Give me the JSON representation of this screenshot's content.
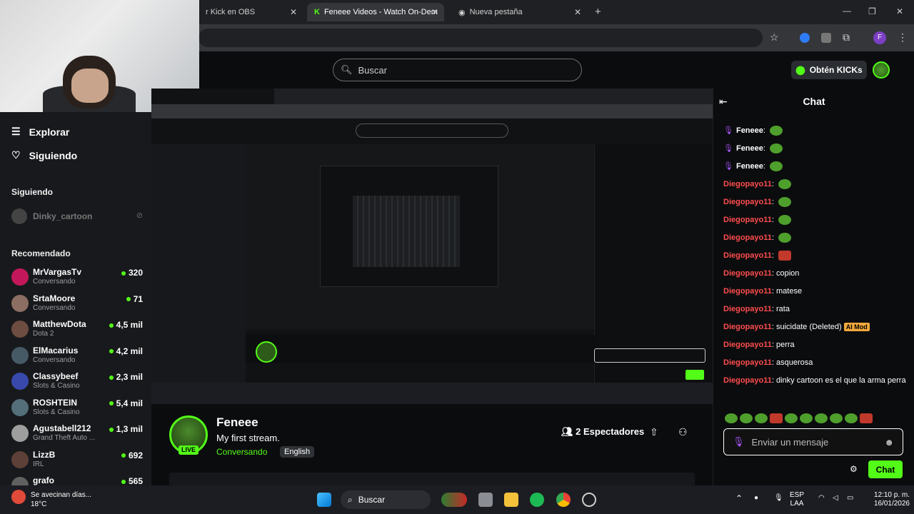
{
  "browser": {
    "tabs": [
      {
        "title": "r Kick en OBS",
        "active": false
      },
      {
        "title": "Feneee Videos - Watch On-Dem",
        "active": true
      },
      {
        "title": "Nueva pestaña",
        "active": false
      }
    ]
  },
  "header": {
    "search_placeholder": "Buscar",
    "kicks_label": "Obtén KICKs"
  },
  "sidebar": {
    "explore": "Explorar",
    "following": "Siguiendo",
    "following_heading": "Siguiendo",
    "following_channel": "Dinky_cartoon",
    "recommended_heading": "Recomendado",
    "recommended": [
      {
        "name": "MrVargasTv",
        "category": "Conversando",
        "viewers": "320"
      },
      {
        "name": "SrtaMoore",
        "category": "Conversando",
        "viewers": "71"
      },
      {
        "name": "MatthewDota",
        "category": "Dota 2",
        "viewers": "4,5 mil"
      },
      {
        "name": "ElMacarius",
        "category": "Conversando",
        "viewers": "4,2 mil"
      },
      {
        "name": "Classybeef",
        "category": "Slots & Casino",
        "viewers": "2,3 mil"
      },
      {
        "name": "ROSHTEIN",
        "category": "Slots & Casino",
        "viewers": "5,4 mil"
      },
      {
        "name": "Agustabell212",
        "category": "Grand Theft Auto ...",
        "viewers": "1,3 mil"
      },
      {
        "name": "LizzB",
        "category": "IRL",
        "viewers": "692"
      },
      {
        "name": "grafo",
        "category": "",
        "viewers": "565"
      }
    ]
  },
  "stream": {
    "streamer": "Feneee",
    "title": "My first stream.",
    "category": "Conversando",
    "language": "English",
    "live": "LIVE",
    "viewers": "2 Espectadores"
  },
  "chat": {
    "title": "Chat",
    "messages": [
      {
        "user": "Feneee",
        "text": "",
        "emotes": 1,
        "color": "#ffffff"
      },
      {
        "user": "Feneee",
        "text": "",
        "emotes": 1,
        "color": "#ffffff"
      },
      {
        "user": "Feneee",
        "text": "",
        "emotes": 1,
        "color": "#ffffff"
      },
      {
        "user": "Diegopayo11",
        "text": "",
        "emotes": 1,
        "color": "#ff4d4d"
      },
      {
        "user": "Diegopayo11",
        "text": "",
        "emotes": 1,
        "color": "#ff4d4d"
      },
      {
        "user": "Diegopayo11",
        "text": "",
        "emotes": 1,
        "color": "#ff4d4d"
      },
      {
        "user": "Diegopayo11",
        "text": "",
        "emotes": 1,
        "color": "#ff4d4d"
      },
      {
        "user": "Diegopayo11",
        "text": "",
        "emotes": 1,
        "color": "#ff4d4d",
        "red": true
      },
      {
        "user": "Diegopayo11",
        "text": "copion",
        "emotes": 0,
        "color": "#ff4d4d"
      },
      {
        "user": "Diegopayo11",
        "text": "matese",
        "emotes": 0,
        "color": "#ff4d4d"
      },
      {
        "user": "Diegopayo11",
        "text": "rata",
        "emotes": 0,
        "color": "#ff4d4d"
      },
      {
        "user": "Diegopayo11",
        "text": "suicidate (Deleted)",
        "emotes": 0,
        "color": "#ff4d4d",
        "badge": "AI Mod"
      },
      {
        "user": "Diegopayo11",
        "text": "perra",
        "emotes": 0,
        "color": "#ff4d4d"
      },
      {
        "user": "Diegopayo11",
        "text": "asquerosa",
        "emotes": 0,
        "color": "#ff4d4d"
      },
      {
        "user": "Diegopayo11",
        "text": "dinky cartoon es el que la arma perra",
        "emotes": 0,
        "color": "#ff4d4d"
      }
    ],
    "input_placeholder": "Enviar un mensaje",
    "send_label": "Chat"
  },
  "taskbar": {
    "weather_text": "Se avecinan días...",
    "weather_temp": "18°C",
    "search": "Buscar",
    "lang_top": "ESP",
    "lang_bottom": "LAA",
    "time": "12:10 p. m.",
    "date": "16/01/2026"
  },
  "colors": {
    "kick_green": "#53fc18",
    "chat_user_red": "#ff4d4d",
    "background": "#0b0c0e"
  }
}
